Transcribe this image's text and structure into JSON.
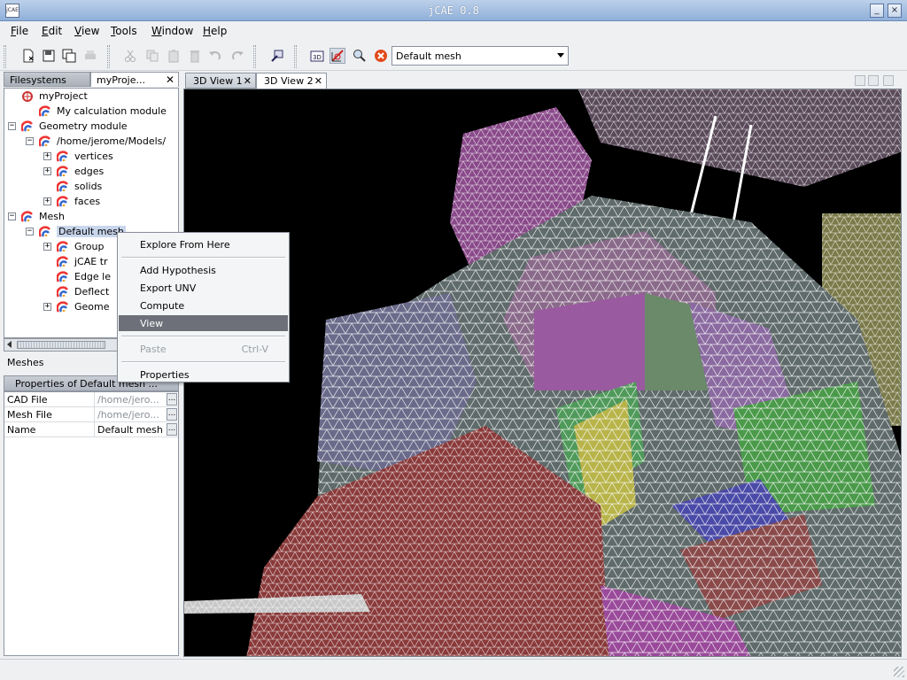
{
  "window": {
    "title": "jCAE 0.8",
    "app_icon_text": "jCAE",
    "controls": [
      "_",
      "□",
      "×"
    ]
  },
  "menubar": {
    "items": [
      "File",
      "Edit",
      "View",
      "Tools",
      "Window",
      "Help"
    ]
  },
  "toolbar": {
    "buttons": [
      {
        "name": "new",
        "icon": "new-document-icon",
        "enabled": true
      },
      {
        "name": "save",
        "icon": "save-icon",
        "enabled": true
      },
      {
        "name": "save-all",
        "icon": "save-all-icon",
        "enabled": true
      },
      {
        "name": "print",
        "icon": "print-icon",
        "enabled": false
      },
      {
        "name": "cut",
        "icon": "cut-icon",
        "enabled": false
      },
      {
        "name": "copy",
        "icon": "copy-icon",
        "enabled": false
      },
      {
        "name": "paste",
        "icon": "paste-icon",
        "enabled": false
      },
      {
        "name": "delete",
        "icon": "delete-icon",
        "enabled": false
      },
      {
        "name": "undo",
        "icon": "undo-icon",
        "enabled": false
      },
      {
        "name": "redo",
        "icon": "redo-icon",
        "enabled": false
      },
      {
        "name": "pick",
        "icon": "pick-tool-icon",
        "enabled": true
      },
      {
        "name": "view-3d",
        "icon": "3d-view-icon",
        "text": "3D",
        "enabled": true
      },
      {
        "name": "mesh-tool",
        "icon": "mesh-tool-icon",
        "enabled": true,
        "pressed": true
      },
      {
        "name": "zoom",
        "icon": "zoom-icon",
        "enabled": true
      },
      {
        "name": "stop",
        "icon": "stop-icon",
        "enabled": true
      }
    ],
    "mesh_select": {
      "value": "Default mesh"
    }
  },
  "explorer": {
    "tabs": [
      {
        "label": "Filesystems",
        "active": false
      },
      {
        "label": "myProje...",
        "active": true
      }
    ],
    "tree": [
      {
        "label": "myProject",
        "icon": "project-icon",
        "expander": "none"
      },
      {
        "label": "My calculation module",
        "icon": "module-icon",
        "expander": "none"
      },
      {
        "label": "Geometry module",
        "icon": "module-icon",
        "expander": "−"
      },
      {
        "label": "/home/jerome/Models/",
        "icon": "module-icon",
        "expander": "−"
      },
      {
        "label": "vertices",
        "icon": "module-icon",
        "expander": "+"
      },
      {
        "label": "edges",
        "icon": "module-icon",
        "expander": "+"
      },
      {
        "label": "solids",
        "icon": "module-icon",
        "expander": "none"
      },
      {
        "label": "faces",
        "icon": "module-icon",
        "expander": "+"
      },
      {
        "label": "Mesh",
        "icon": "module-icon",
        "expander": "−"
      },
      {
        "label": "Default mesh",
        "icon": "module-icon",
        "expander": "−",
        "selected": true
      },
      {
        "label": "Group",
        "icon": "module-icon",
        "expander": "+"
      },
      {
        "label": "jCAE tr",
        "icon": "module-icon",
        "expander": "none"
      },
      {
        "label": "Edge le",
        "icon": "module-icon",
        "expander": "none"
      },
      {
        "label": "Deflect",
        "icon": "module-icon",
        "expander": "none"
      },
      {
        "label": "Geome",
        "icon": "module-icon",
        "expander": "+"
      }
    ]
  },
  "meshes_label": "Meshes",
  "properties": {
    "header": "Properties of Default mesh ...",
    "rows": [
      {
        "name": "CAD File",
        "value": "/home/jero...",
        "dim": true
      },
      {
        "name": "Mesh File",
        "value": "/home/jero...",
        "dim": true
      },
      {
        "name": "Name",
        "value": "Default mesh",
        "dim": false
      }
    ],
    "button_label": "..."
  },
  "views": {
    "tabs": [
      {
        "label": "3D View 1",
        "active": false
      },
      {
        "label": "3D View 2",
        "active": true
      }
    ]
  },
  "context_menu": {
    "items": [
      {
        "label": "Explore From Here",
        "accel": "",
        "state": "normal"
      },
      {
        "separator": true
      },
      {
        "label": "Add Hypothesis",
        "accel": "",
        "state": "normal"
      },
      {
        "label": "Export UNV",
        "accel": "",
        "state": "normal"
      },
      {
        "label": "Compute",
        "accel": "",
        "state": "normal"
      },
      {
        "label": "View",
        "accel": "",
        "state": "active"
      },
      {
        "separator": true
      },
      {
        "label": "Paste",
        "accel": "Ctrl-V",
        "state": "disabled"
      },
      {
        "separator": true
      },
      {
        "label": "Properties",
        "accel": "",
        "state": "normal"
      }
    ]
  },
  "colors": {
    "title_bar": "#9db8de",
    "viewport_bg": "#000000",
    "menu_highlight": "#6d7079",
    "tree_selection": "#c8d6ec"
  }
}
